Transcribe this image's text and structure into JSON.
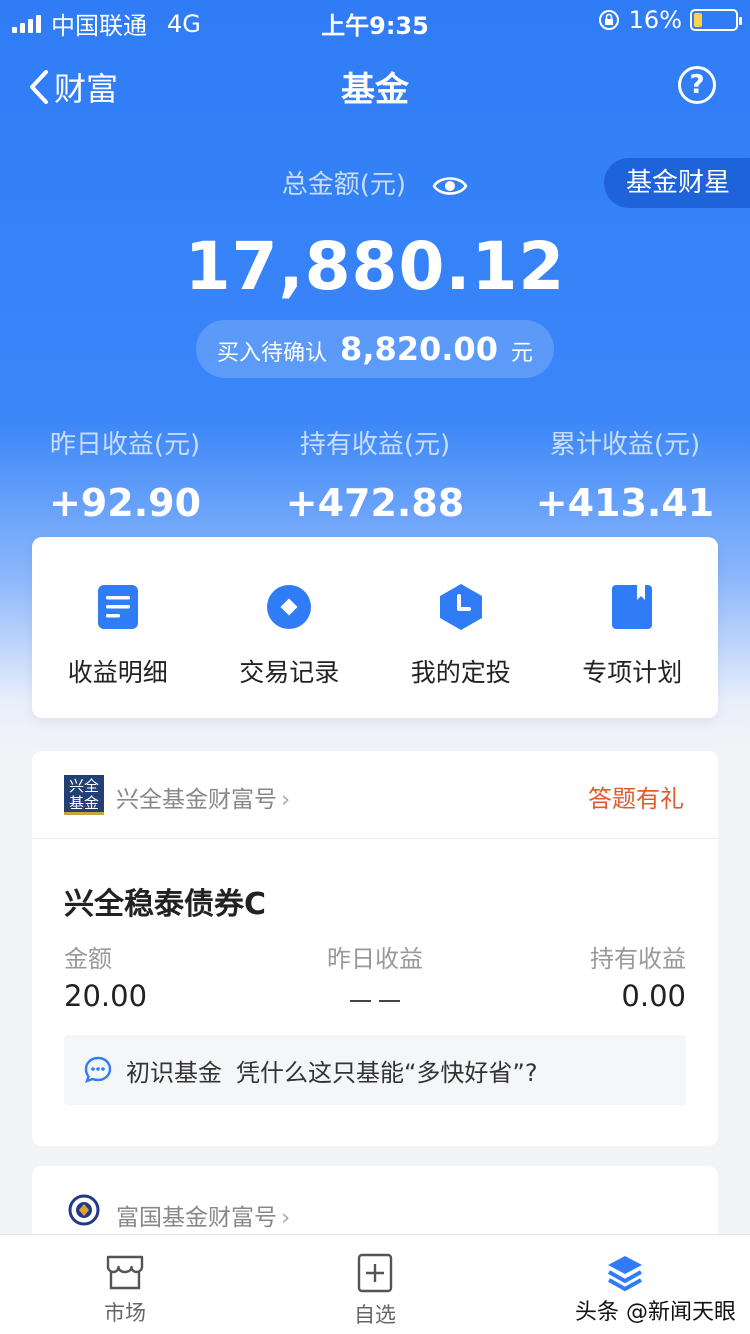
{
  "status_bar": {
    "carrier": "中国联通",
    "network": "4G",
    "time": "上午9:35",
    "battery": "16%",
    "battery_level": 0.16
  },
  "nav": {
    "back_label": "财富",
    "title": "基金",
    "help_symbol": "?"
  },
  "summary": {
    "total_label": "总金额(元)",
    "star_button": "基金财星",
    "total_amount": "17,880.12",
    "pending_label": "买入待确认",
    "pending_amount": "8,820.00",
    "pending_unit": "元",
    "stats": [
      {
        "label": "昨日收益(元)",
        "value": "+92.90"
      },
      {
        "label": "持有收益(元)",
        "value": "+472.88"
      },
      {
        "label": "累计收益(元)",
        "value": "+413.41"
      }
    ]
  },
  "shortcuts": [
    {
      "label": "收益明细",
      "icon": "document-icon"
    },
    {
      "label": "交易记录",
      "icon": "record-icon"
    },
    {
      "label": "我的定投",
      "icon": "clock-icon"
    },
    {
      "label": "专项计划",
      "icon": "bookmark-icon"
    }
  ],
  "fund_card": {
    "logo_text_top": "兴全",
    "logo_text_bottom": "基金",
    "house_name": "兴全基金财富号",
    "quiz_link": "答题有礼",
    "fund_name": "兴全稳泰债券C",
    "col_amount_label": "金额",
    "col_yesterday_label": "昨日收益",
    "col_hold_label": "持有收益",
    "amount": "20.00",
    "yesterday": "－－",
    "hold": "0.00",
    "tip_tag": "初识基金",
    "tip_text": "凭什么这只基能“多快好省”?"
  },
  "fund_card_2": {
    "house_name": "富国基金财富号"
  },
  "tabbar": [
    {
      "label": "市场",
      "icon": "market-icon"
    },
    {
      "label": "自选",
      "icon": "add-watchlist-icon"
    },
    {
      "label": "",
      "icon": "layers-icon"
    }
  ],
  "watermark": "头条 @新闻天眼",
  "colors": {
    "primary": "#2f7cf6",
    "accent_orange": "#e05c2e",
    "logo_navy": "#233f77"
  }
}
